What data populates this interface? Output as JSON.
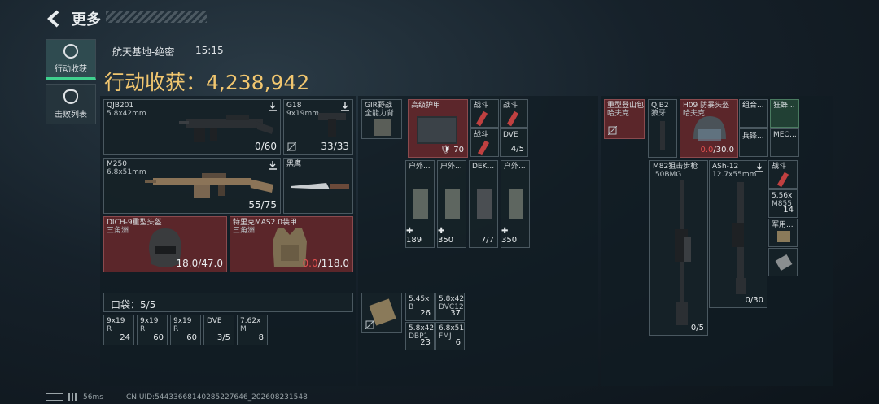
{
  "header": {
    "title": "更多"
  },
  "tabs": [
    {
      "label": "行动收获",
      "icon": "loot-icon",
      "active": true
    },
    {
      "label": "击败列表",
      "icon": "skull-icon",
      "active": false
    }
  ],
  "raid": {
    "map": "航天基地-绝密",
    "time": "15:15",
    "haul_label": "行动收获：4,238,942"
  },
  "weapons": {
    "qjb201": {
      "name": "QJB201",
      "caliber": "5.8x42mm",
      "ammo": "0/60"
    },
    "g18": {
      "name": "G18",
      "caliber": "9x19mm",
      "ammo": "33/33"
    },
    "m250": {
      "name": "M250",
      "caliber": "6.8x51mm",
      "ammo": "55/75"
    },
    "knife": {
      "name": "黑鹰"
    },
    "helmet": {
      "name": "DICH-9重型头盔",
      "sub": "三角洲",
      "dur_cur": "18.0",
      "dur_max": "/47.0"
    },
    "armor": {
      "name": "特里克MAS2.0装甲",
      "sub": "三角洲",
      "dur_cur": "0.0",
      "dur_max": "/118.0"
    }
  },
  "pocket": {
    "label": "口袋：",
    "count": "5/5",
    "items": [
      {
        "l1": "9x19",
        "l2": "R",
        "num": "24"
      },
      {
        "l1": "9x19",
        "l2": "R",
        "num": "60"
      },
      {
        "l1": "9x19",
        "l2": "R",
        "num": "60"
      },
      {
        "l1": "DVE",
        "l2": "",
        "num": "3/5"
      },
      {
        "l1": "7.62x",
        "l2": "M",
        "num": "8"
      }
    ]
  },
  "middle": {
    "rig": {
      "l1": "GIR野战",
      "l2": "全能力背"
    },
    "body_armor": {
      "l1": "高级护甲",
      "num": "70"
    },
    "meds": [
      {
        "l1": "战斗"
      },
      {
        "l1": "战斗"
      },
      {
        "l1": "战斗"
      },
      {
        "l1": "DVE",
        "num": "4/5"
      }
    ],
    "cases": [
      {
        "l1": "户外...",
        "num": "189"
      },
      {
        "l1": "户外...",
        "num": "350"
      },
      {
        "l1": "DEK...",
        "num": "7/7"
      },
      {
        "l1": "户外...",
        "num": "350"
      }
    ],
    "ammo": [
      {
        "l1": "5.45x",
        "l2": "B",
        "num": "26"
      },
      {
        "l1": "5.8x42",
        "l2": "DVC12",
        "num": "37"
      },
      {
        "l1": "5.8x42",
        "l2": "DBP1",
        "num": "23"
      },
      {
        "l1": "6.8x51",
        "l2": "FMJ",
        "num": "6"
      }
    ]
  },
  "right": {
    "backpack": {
      "l1": "重型登山包",
      "l2": "哈夫克"
    },
    "qjb2": {
      "l1": "QJB2",
      "l2": "狼牙"
    },
    "h09": {
      "l1": "H09 防暴头盔",
      "l2": "哈夫克",
      "dur_cur": "0.0",
      "dur_max": "/30.0"
    },
    "combo": {
      "l1": "组合..."
    },
    "bee": {
      "l1": "狂蜂..."
    },
    "soldier": {
      "l1": "兵锋..."
    },
    "meo": {
      "l1": "MEO..."
    },
    "m82": {
      "name": "M82狙击步枪",
      "caliber": ".50BMG",
      "ammo": "0/5"
    },
    "ash12": {
      "name": "ASh-12",
      "caliber": "12.7x55mm",
      "ammo": "0/30"
    },
    "side": [
      {
        "l1": "战斗"
      },
      {
        "l1": "5.56x",
        "l2": "M855",
        "num": "14"
      },
      {
        "l1": "军用..."
      },
      {
        "l1": ""
      }
    ]
  },
  "footer": {
    "ping": "56ms",
    "uid": "CN UID:5443366814028522764​6_202608231548"
  },
  "colors": {
    "accent_gold": "#f1c66f",
    "accent_green": "#3fd18e",
    "damage_red": "#e05050"
  }
}
